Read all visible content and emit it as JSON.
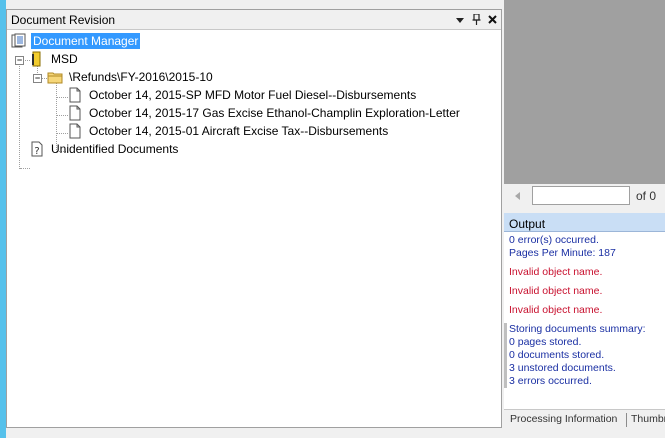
{
  "document_revision": {
    "title": "Document Revision",
    "controls": {
      "dropdown": "▾",
      "pin": "📌",
      "close": "✕"
    },
    "tree": {
      "root": "Document Manager",
      "msd": "MSD",
      "folder": "\\Refunds\\FY-2016\\2015-10",
      "docs": [
        "October 14, 2015-SP MFD Motor Fuel Diesel--Disbursements",
        "October 14, 2015-17 Gas Excise Ethanol-Champlin Exploration-Letter",
        "October 14, 2015-01 Aircraft Excise Tax--Disbursements"
      ],
      "unidentified": "Unidentified Documents"
    }
  },
  "navigator": {
    "page_value": "",
    "of_label": "of 0"
  },
  "output": {
    "title": "Output",
    "lines": [
      "0 error(s) occurred.",
      "Pages Per Minute: 187",
      "Invalid object name.",
      "Invalid object name.",
      "Invalid object name.",
      "Storing documents summary:",
      "0 pages stored.",
      "0 documents stored.",
      "3 unstored documents.",
      "3 errors occurred."
    ]
  },
  "tabs": [
    "Processing Information",
    "Thumbn"
  ],
  "colors": {
    "accent": "#56c1eb",
    "selection": "#3399ff",
    "output_blue": "#1a2fa3",
    "output_red": "#c8102e",
    "output_header": "#c9def5"
  }
}
